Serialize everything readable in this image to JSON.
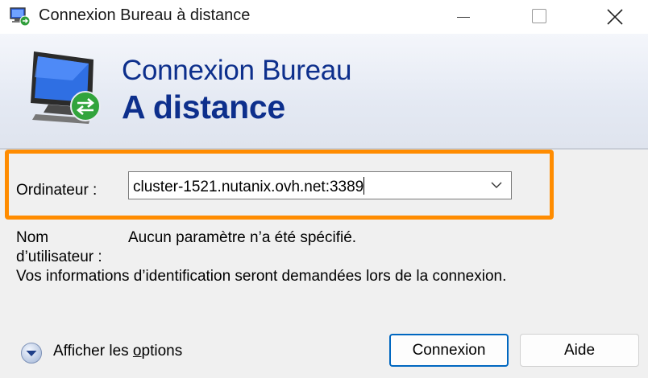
{
  "window": {
    "title": "Connexion Bureau à distance",
    "controls": {
      "minimize": "minimize",
      "maximize": "maximize",
      "close": "close"
    }
  },
  "banner": {
    "line1": "Connexion Bureau",
    "line2": "A distance"
  },
  "computer": {
    "label": "Ordinateur :",
    "value": "cluster-1521.nutanix.ovh.net:3389"
  },
  "user": {
    "label_line1": "Nom",
    "label_line2": "d’utilisateur :",
    "value": "Aucun paramètre n’a été spécifié."
  },
  "note": "Vos informations d’identification seront demandées lors de la connexion.",
  "options": {
    "label_prefix": "Afficher les ",
    "label_underlined": "o",
    "label_suffix": "ptions"
  },
  "buttons": {
    "connect": "Connexion",
    "help": "Aide"
  },
  "colors": {
    "accent_blue": "#0d2f8c",
    "highlight_orange": "#ff8c00",
    "default_button_border": "#0067c0"
  }
}
